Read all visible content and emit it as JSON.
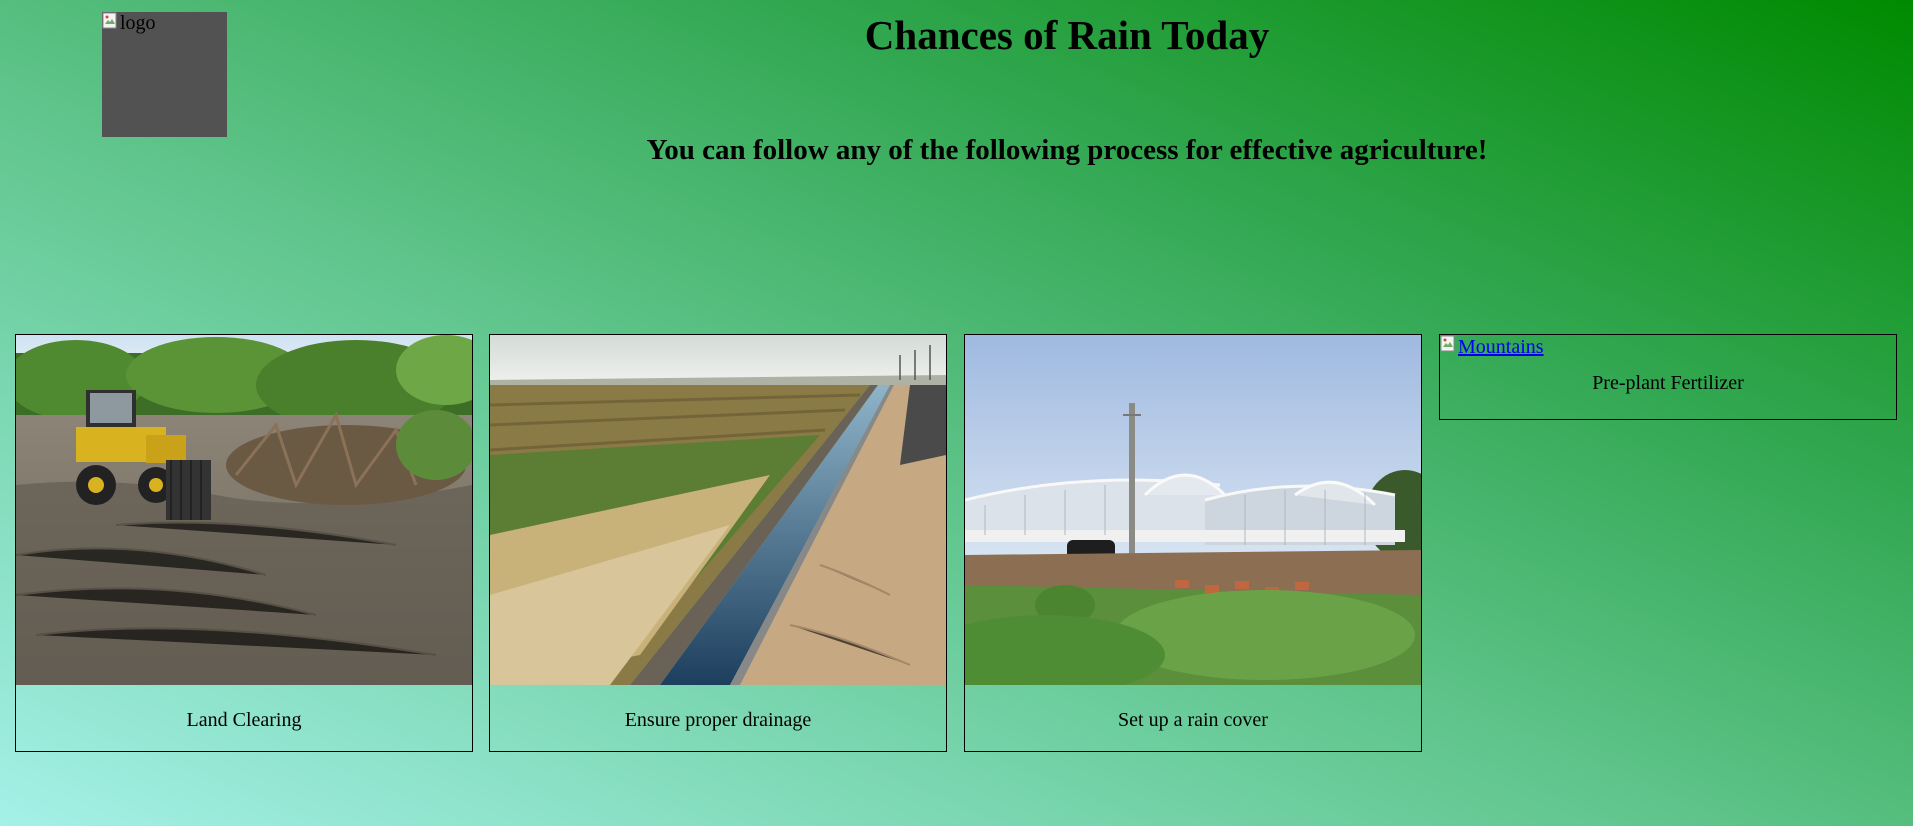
{
  "header": {
    "logo_alt": "logo",
    "title": "Chances of Rain Today",
    "subtitle": "You can follow any of the following process for effective agriculture!"
  },
  "cards": [
    {
      "caption": "Land Clearing",
      "image": "bulldozer-clearing-field"
    },
    {
      "caption": "Ensure proper drainage",
      "image": "irrigation-canal"
    },
    {
      "caption": "Set up a rain cover",
      "image": "greenhouse-tunnels"
    },
    {
      "caption": "Pre-plant Fertilizer",
      "image_alt": "Mountains",
      "image_broken": true
    }
  ],
  "colors": {
    "background_start": "#a4f1e8",
    "background_end": "#008a00",
    "logo_placeholder": "#525252",
    "link": "#0000ee"
  }
}
